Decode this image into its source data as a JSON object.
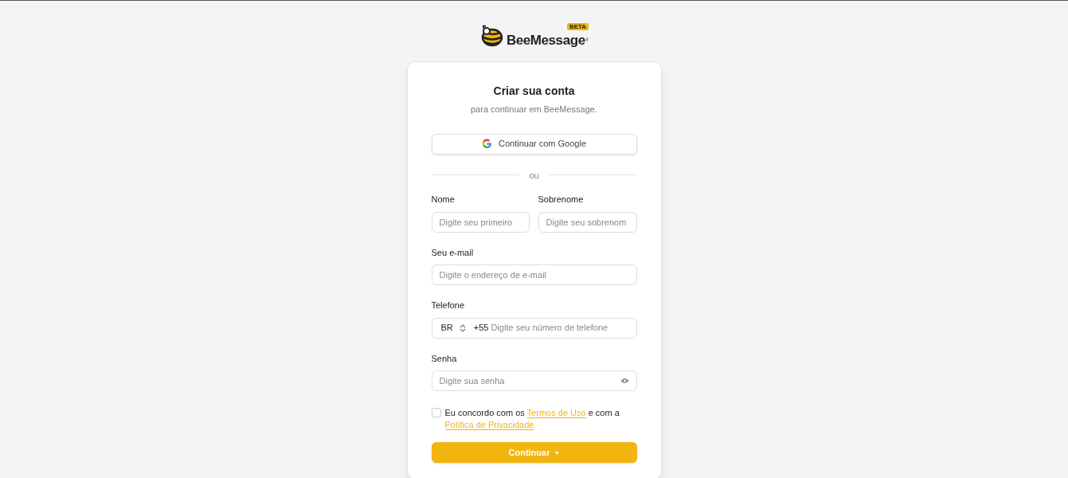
{
  "logo": {
    "name": "BeeMessage",
    "mark": "®",
    "badge": "BETA"
  },
  "card": {
    "title": "Criar sua conta",
    "subtitle": "para continuar em BeeMessage."
  },
  "google_button": {
    "label": "Continuar com Google"
  },
  "divider": {
    "label": "ou"
  },
  "fields": [
    {
      "kind": "half",
      "label": "Nome",
      "placeholder": "Digite seu primeiro"
    },
    {
      "kind": "half",
      "label": "Sobrenome",
      "placeholder": "Digite seu sobrenom"
    },
    {
      "kind": "text",
      "label": "Seu e-mail",
      "placeholder": "Digite o endereço de e-mail"
    },
    {
      "kind": "phone",
      "label": "Telefone",
      "country": "BR",
      "code": "+55",
      "placeholder": "Digite seu número de telefone"
    },
    {
      "kind": "password",
      "label": "Senha",
      "placeholder": "Digite sua senha"
    }
  ],
  "terms": {
    "checked": false,
    "before": "Eu concordo com os",
    "link1": "Termos de Uso",
    "middle": "e com a",
    "link2": "Política de Privacidade"
  },
  "submit": {
    "label": "Continuar",
    "arrow": "▸"
  }
}
